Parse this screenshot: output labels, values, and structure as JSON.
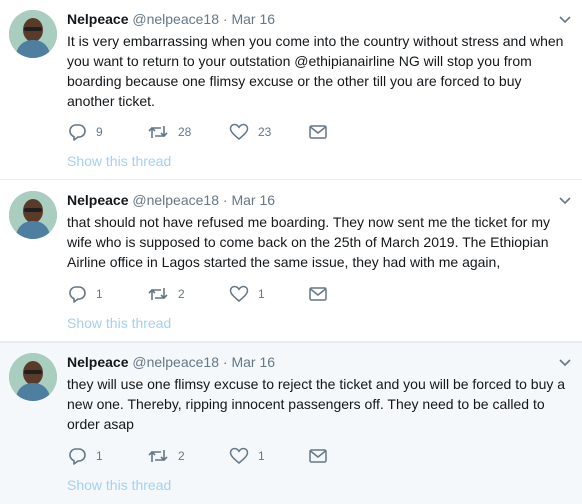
{
  "tweets": [
    {
      "name": "Nelpeace",
      "handle": "@nelpeace18",
      "separator": "·",
      "date": "Mar 16",
      "text": "It is very embarrassing when you come into the country without stress and when you want to return to your outstation @ethipianairline NG will stop you from boarding because one flimsy excuse or the other till you are forced to buy another ticket.",
      "replies": "9",
      "retweets": "28",
      "likes": "23",
      "show_thread": "Show this thread"
    },
    {
      "name": "Nelpeace",
      "handle": "@nelpeace18",
      "separator": "·",
      "date": "Mar 16",
      "text": "that should not have refused me boarding. They now sent me the ticket for my wife who is supposed to come back on the 25th of March 2019. The Ethiopian Airline office in Lagos started the same issue, they had with me again,",
      "replies": "1",
      "retweets": "2",
      "likes": "1",
      "show_thread": "Show this thread"
    },
    {
      "name": "Nelpeace",
      "handle": "@nelpeace18",
      "separator": "·",
      "date": "Mar 16",
      "text": "they will use one flimsy excuse to reject the ticket and you will be forced to buy a new one. Thereby, ripping innocent passengers off. They need to be called to order asap",
      "replies": "1",
      "retweets": "2",
      "likes": "1",
      "show_thread": "Show this thread"
    }
  ],
  "colors": {
    "name": "#14171a",
    "secondary": "#657786",
    "link": "#a4d0f2",
    "highlight_bg": "#f5f8fa",
    "divider": "#e6ecf0"
  }
}
